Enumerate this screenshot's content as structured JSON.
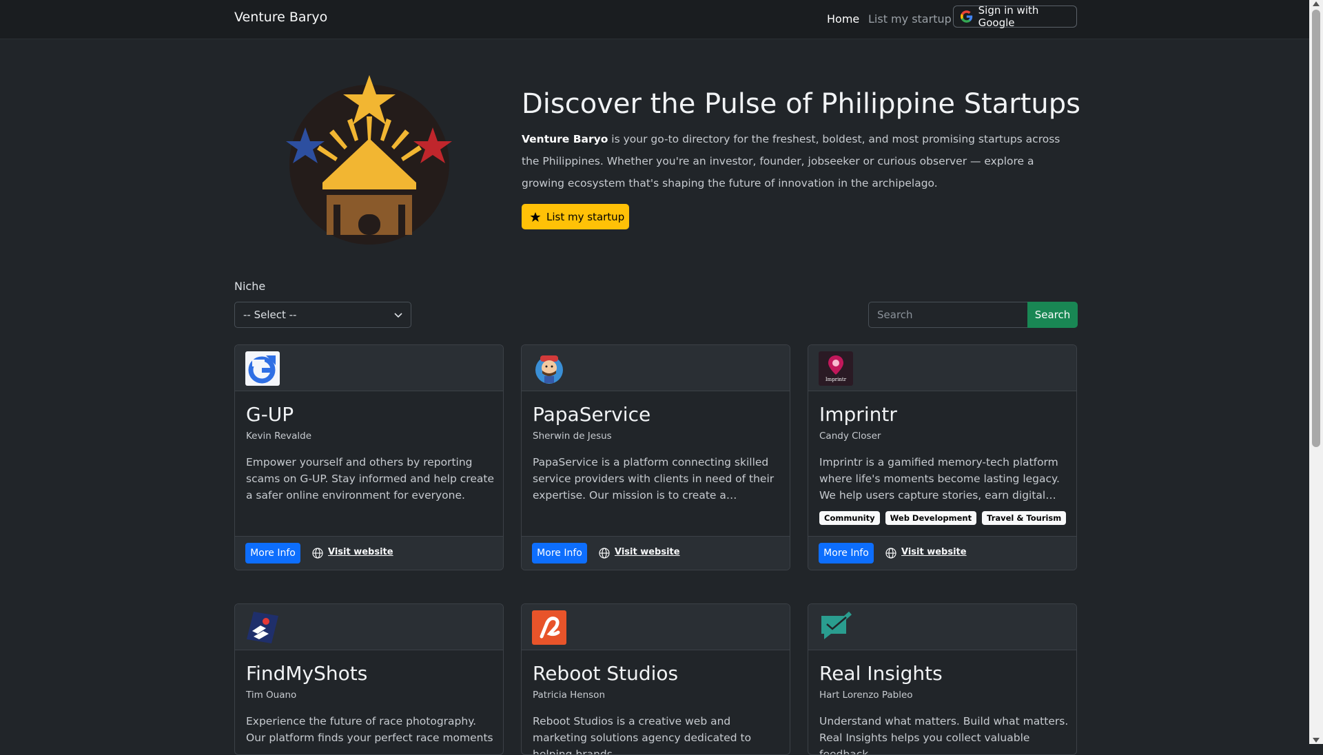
{
  "nav": {
    "brand": "Venture Baryo",
    "home": "Home",
    "list": "List my startup",
    "signin": "Sign in with Google"
  },
  "hero": {
    "title": "Discover the Pulse of Philippine Startups",
    "brand_bold": "Venture Baryo",
    "text": " is your go-to directory for the freshest, boldest, and most promising startups across the Philippines. Whether you're an investor, founder, jobseeker or curious observer — explore a growing ecosystem that's shaping the future of innovation in the archipelago.",
    "cta": "List my startup"
  },
  "filters": {
    "niche_label": "Niche",
    "niche_value": "-- Select --",
    "search_placeholder": "Search",
    "search_button": "Search"
  },
  "cards": [
    {
      "name": "G-UP",
      "founder": "Kevin Revalde",
      "description": "Empower yourself and others by reporting scams on G-UP. Stay informed and help create a safer online environment for everyone.",
      "more": "More Info",
      "visit": "Visit website",
      "logo": "gup-logo",
      "tags": []
    },
    {
      "name": "PapaService",
      "founder": "Sherwin de Jesus",
      "description": "PapaService is a platform connecting skilled service providers with clients in need of their expertise. Our mission is to create a transparent marketplace for services.",
      "more": "More Info",
      "visit": "Visit website",
      "logo": "papaservice-logo",
      "tags": []
    },
    {
      "name": "Imprintr",
      "founder": "Candy Closer",
      "description": "Imprintr is a gamified memory-tech platform where life's moments become lasting legacy. We help users capture stories, earn digital memory keepsakes.",
      "more": "More Info",
      "visit": "Visit website",
      "logo": "imprintr-logo",
      "logo_text": "Imprintr",
      "tags": [
        "Community",
        "Web Development",
        "Travel & Tourism"
      ]
    },
    {
      "name": "FindMyShots",
      "founder": "Tim Ouano",
      "description": "Experience the future of race photography. Our platform finds your perfect race moments",
      "logo": "findmyshots-logo",
      "tags": []
    },
    {
      "name": "Reboot Studios",
      "founder": "Patricia Henson",
      "description": "Reboot Studios is a creative web and marketing solutions agency dedicated to helping brands",
      "logo": "reboot-logo",
      "tags": []
    },
    {
      "name": "Real Insights",
      "founder": "Hart Lorenzo Pableo",
      "description": "Understand what matters. Build what matters. Real Insights helps you collect valuable feedback",
      "logo": "realinsights-logo",
      "tags": []
    }
  ],
  "colors": {
    "background": "#212529",
    "navbar": "#1a1d20",
    "cta_yellow": "#ffc107",
    "primary_blue": "#0d6efd",
    "success_green": "#198754"
  }
}
